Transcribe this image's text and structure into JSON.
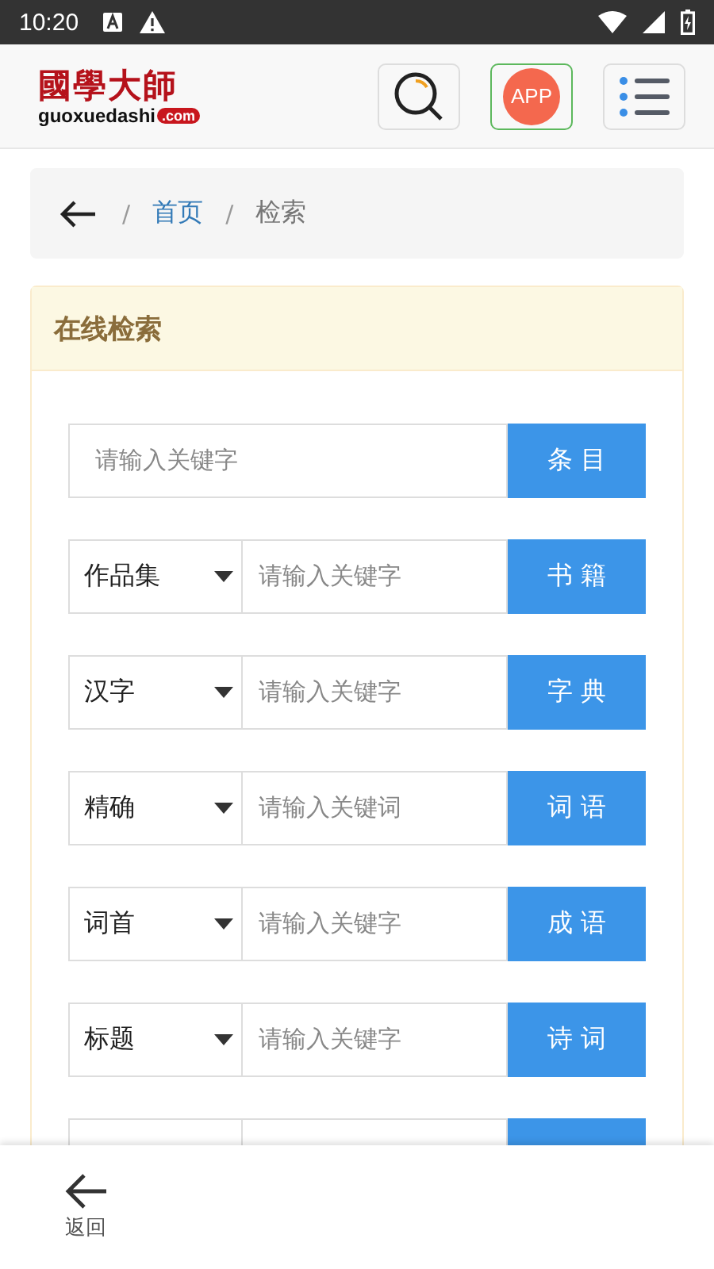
{
  "status_bar": {
    "time": "10:20"
  },
  "header": {
    "logo_title": "國學大師",
    "logo_domain": "guoxuedashi",
    "logo_tld": ".com",
    "app_button": "APP"
  },
  "breadcrumb": {
    "items": [
      {
        "separator": "/",
        "label": "首页",
        "kind": "link"
      },
      {
        "separator": "/",
        "label": "检索",
        "kind": "current"
      }
    ]
  },
  "panel": {
    "title": "在线检索",
    "rows": [
      {
        "kind": "plain",
        "placeholder": "请输入关键字",
        "button": "条 目"
      },
      {
        "kind": "select",
        "select": "作品集",
        "placeholder": "请输入关键字",
        "button": "书 籍"
      },
      {
        "kind": "select",
        "select": "汉字",
        "placeholder": "请输入关键字",
        "button": "字 典"
      },
      {
        "kind": "select",
        "select": "精确",
        "placeholder": "请输入关键词",
        "button": "词 语"
      },
      {
        "kind": "select",
        "select": "词首",
        "placeholder": "请输入关键字",
        "button": "成 语"
      },
      {
        "kind": "select",
        "select": "标题",
        "placeholder": "请输入关键字",
        "button": "诗 词"
      },
      {
        "kind": "cut"
      }
    ]
  },
  "bottom_bar": {
    "back": "返回"
  }
}
